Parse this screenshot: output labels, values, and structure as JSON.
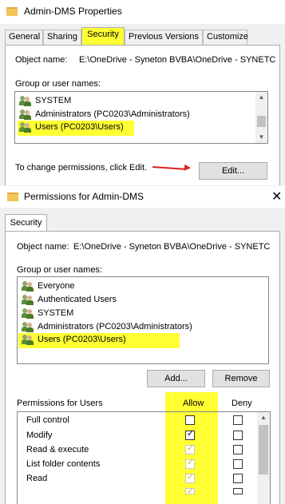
{
  "properties_window": {
    "title": "Admin-DMS Properties",
    "tabs": [
      {
        "label": "General"
      },
      {
        "label": "Sharing"
      },
      {
        "label": "Security"
      },
      {
        "label": "Previous Versions"
      },
      {
        "label": "Customize"
      }
    ],
    "active_tab": "Security",
    "object_name_label": "Object name:",
    "object_name_value": "E:\\OneDrive - Syneton BVBA\\OneDrive - SYNETC",
    "group_label": "Group or user names:",
    "users": [
      {
        "name": "SYSTEM"
      },
      {
        "name": "Administrators (PC0203\\Administrators)"
      },
      {
        "name": "Users (PC0203\\Users)"
      }
    ],
    "change_text": "To change permissions, click Edit.",
    "edit_button": "Edit...",
    "highlight_color": "#ffff33",
    "arrow_color": "#e02020"
  },
  "permissions_window": {
    "title": "Permissions for Admin-DMS",
    "tab": "Security",
    "object_name_label": "Object name:",
    "object_name_value": "E:\\OneDrive - Syneton BVBA\\OneDrive - SYNETC",
    "group_label": "Group or user names:",
    "users": [
      {
        "name": "Everyone"
      },
      {
        "name": "Authenticated Users"
      },
      {
        "name": "SYSTEM"
      },
      {
        "name": "Administrators (PC0203\\Administrators)"
      },
      {
        "name": "Users (PC0203\\Users)"
      }
    ],
    "add_button": "Add...",
    "remove_button": "Remove",
    "permissions_for_label": "Permissions for Users",
    "allow_header": "Allow",
    "deny_header": "Deny",
    "permissions": [
      {
        "name": "Full control",
        "allow": "unchecked",
        "deny": "unchecked"
      },
      {
        "name": "Modify",
        "allow": "checked",
        "deny": "unchecked"
      },
      {
        "name": "Read & execute",
        "allow": "checked-disabled",
        "deny": "unchecked"
      },
      {
        "name": "List folder contents",
        "allow": "checked-disabled",
        "deny": "unchecked"
      },
      {
        "name": "Read",
        "allow": "checked-disabled",
        "deny": "unchecked"
      }
    ]
  }
}
